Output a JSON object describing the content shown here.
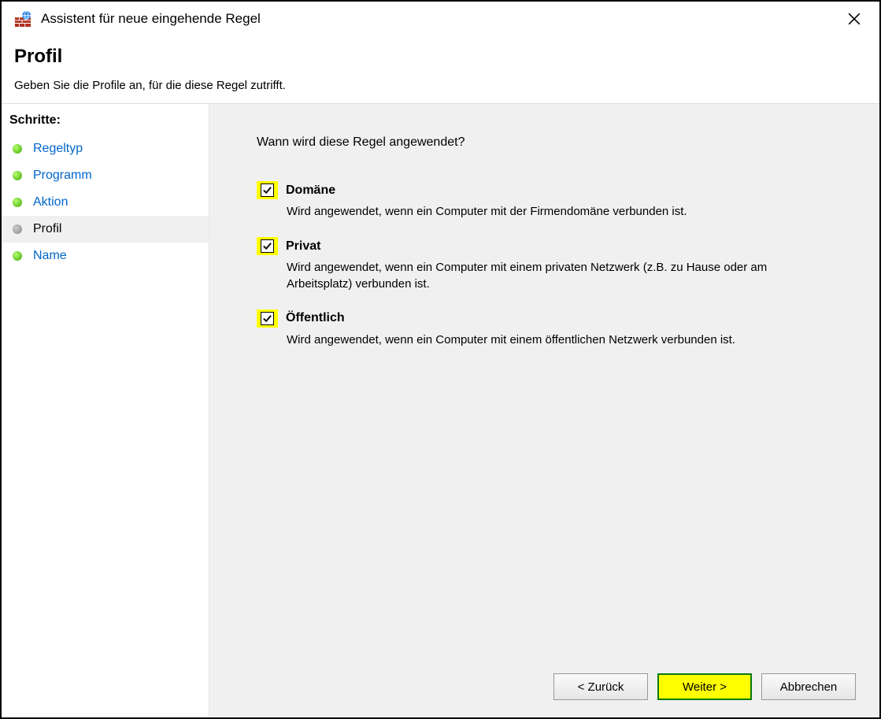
{
  "window": {
    "title": "Assistent für neue eingehende Regel"
  },
  "header": {
    "title": "Profil",
    "subtitle": "Geben Sie die Profile an, für die diese Regel zutrifft."
  },
  "sidebar": {
    "title": "Schritte:",
    "steps": [
      {
        "label": "Regeltyp"
      },
      {
        "label": "Programm"
      },
      {
        "label": "Aktion"
      },
      {
        "label": "Profil"
      },
      {
        "label": "Name"
      }
    ],
    "active_index": 3
  },
  "content": {
    "question": "Wann wird diese Regel angewendet?",
    "options": [
      {
        "label": "Domäne",
        "checked": true,
        "description": "Wird angewendet, wenn ein Computer mit der Firmendomäne verbunden ist."
      },
      {
        "label": "Privat",
        "checked": true,
        "description": "Wird angewendet, wenn ein Computer mit einem privaten Netzwerk (z.B. zu Hause oder am Arbeitsplatz) verbunden ist."
      },
      {
        "label": "Öffentlich",
        "checked": true,
        "description": "Wird angewendet, wenn ein Computer mit einem öffentlichen Netzwerk verbunden ist."
      }
    ]
  },
  "footer": {
    "back": "< Zurück",
    "next": "Weiter >",
    "cancel": "Abbrechen"
  }
}
